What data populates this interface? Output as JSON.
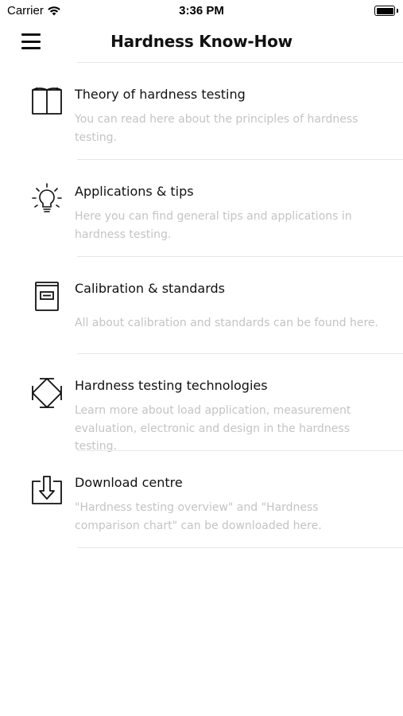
{
  "status_bar": {
    "carrier": "Carrier",
    "time": "3:36 PM",
    "wifi_icon": "wifi-icon",
    "battery_icon": "battery-icon",
    "battery_level": 1.0
  },
  "nav": {
    "title": "Hardness Know-How",
    "menu_icon": "hamburger-menu-icon"
  },
  "items": [
    {
      "title": "Theory of hardness testing",
      "description": "You can read here about the principles of hardness testing.",
      "icon": "open-book-icon"
    },
    {
      "title": "Applications & tips",
      "description": "Here you can find general tips and applications in hardness testing.",
      "icon": "lightbulb-icon"
    },
    {
      "title": "Calibration & standards",
      "description": "All about calibration and standards can be found here.",
      "icon": "binder-icon"
    },
    {
      "title": "Hardness testing technologies",
      "description": "Learn more about load application, measurement evaluation, electronic and design in the hardness testing.",
      "icon": "diamond-indenter-icon"
    },
    {
      "title": "Download centre",
      "description": "\"Hardness testing overview\" and \"Hardness comparison chart\" can be downloaded here.",
      "icon": "download-icon"
    }
  ]
}
